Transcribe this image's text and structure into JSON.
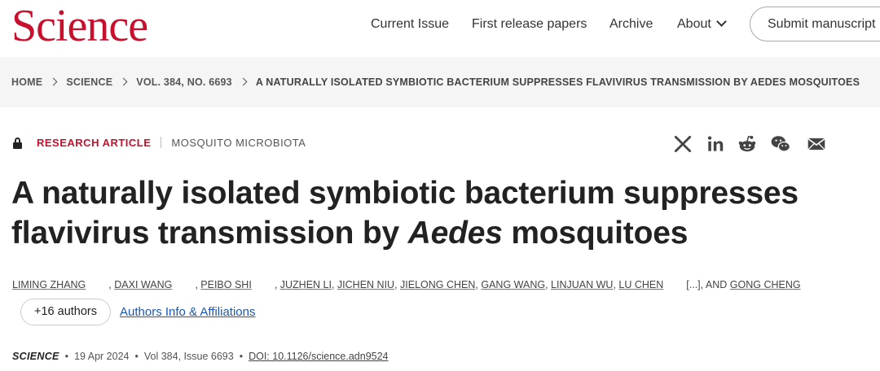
{
  "header": {
    "logo": "Science",
    "nav": [
      "Current Issue",
      "First release papers",
      "Archive",
      "About"
    ],
    "submit_label": "Submit manuscript"
  },
  "breadcrumb": {
    "home": "HOME",
    "journal": "SCIENCE",
    "issue": "VOL. 384, NO. 6693",
    "current": "A NATURALLY ISOLATED SYMBIOTIC BACTERIUM SUPPRESSES FLAVIVIRUS TRANSMISSION BY AEDES MOSQUITOES"
  },
  "article": {
    "type": "RESEARCH ARTICLE",
    "topic": "MOSQUITO MICROBIOTA",
    "title_part1": "A naturally isolated symbiotic bacterium suppresses flavivirus transmission by",
    "title_italic": "Aedes",
    "title_part2": "mosquitoes"
  },
  "share_icons": [
    "x-icon",
    "linkedin-icon",
    "reddit-icon",
    "wechat-icon",
    "email-icon"
  ],
  "authors": {
    "list": [
      "LIMING ZHANG",
      "DAXI WANG",
      "PEIBO SHI",
      "JUZHEN LI",
      "JICHEN NIU",
      "JIELONG CHEN",
      "GANG WANG",
      "LINJUAN WU",
      "LU CHEN"
    ],
    "ellipsis": "[...]",
    "and_text": ", AND",
    "last": "GONG CHENG",
    "more_label": "+16 authors",
    "affiliations_label": "Authors Info & Affiliations"
  },
  "citation": {
    "journal": "SCIENCE",
    "date": "19 Apr 2024",
    "volume": "Vol 384, Issue 6693",
    "doi": "DOI: 10.1126/science.adn9524"
  },
  "colors": {
    "brand": "#c8102e",
    "link": "#1a57b5"
  }
}
